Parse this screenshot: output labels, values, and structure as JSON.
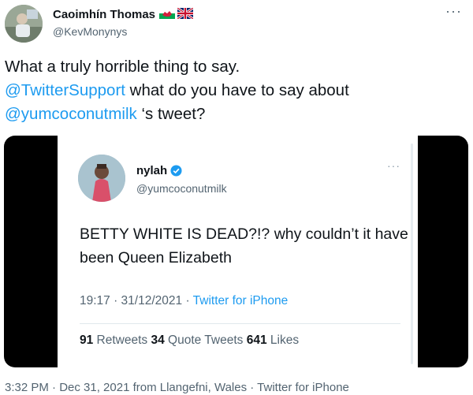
{
  "author": {
    "display_name": "Caoimhín Thomas",
    "handle": "@KevMonynys",
    "flags": [
      "wales-flag-icon",
      "uk-flag-icon"
    ]
  },
  "menu": {
    "more": "···"
  },
  "tweet": {
    "line1": "What a truly horrible thing to say.",
    "mention1": "@TwitterSupport",
    "line2_rest": " what do you have to say about",
    "mention2": "@yumcoconutmilk",
    "line3_rest": " ‘s tweet?"
  },
  "embedded": {
    "name": "nylah",
    "verified_icon": "verified-badge-icon",
    "handle": "@yumcoconutmilk",
    "more": "···",
    "text": "BETTY WHITE IS DEAD?!? why couldn’t it have been Queen Elizabeth",
    "time": "19:17 · 31/12/2021 · ",
    "source": "Twitter for iPhone",
    "retweets_count": "91",
    "retweets_label": " Retweets ",
    "quotes_count": "34",
    "quotes_label": " Quote Tweets ",
    "likes_count": "641",
    "likes_label": " Likes"
  },
  "footer": {
    "meta": "3:32 PM · Dec 31, 2021 from Llangefni, Wales · Twitter for iPhone"
  },
  "colors": {
    "link": "#1d9bf0",
    "muted": "#536471",
    "text": "#0f1419"
  }
}
